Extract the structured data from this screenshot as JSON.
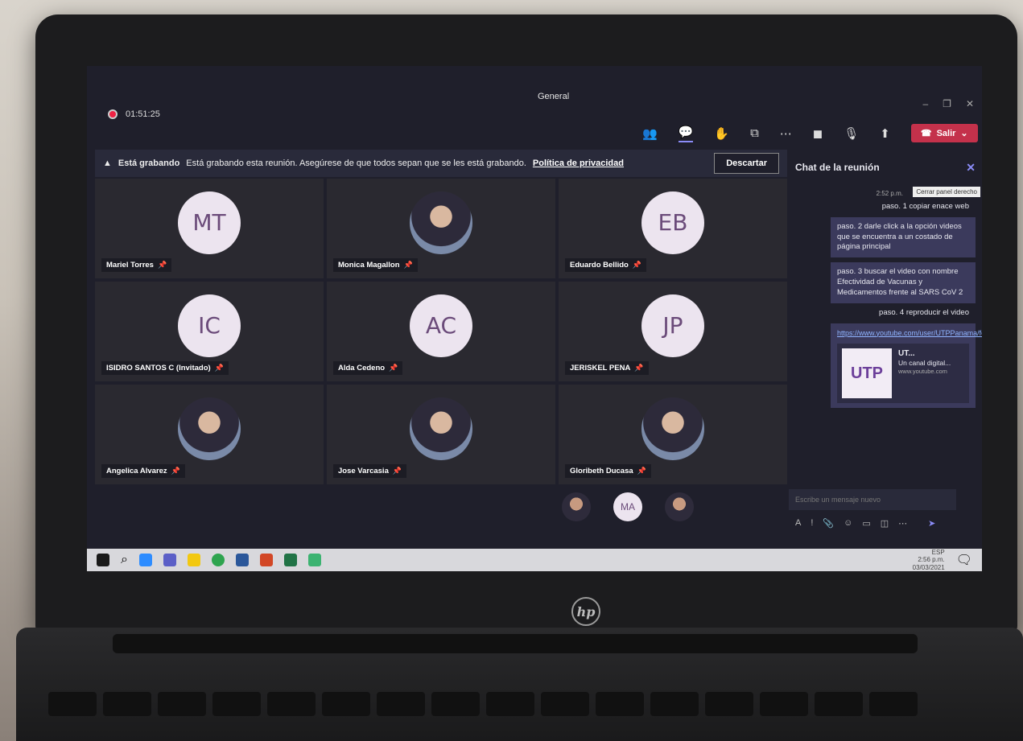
{
  "window": {
    "title": "General",
    "controls": [
      "–",
      "❐",
      "✕"
    ]
  },
  "recording": {
    "timer": "01:51:25"
  },
  "toolbar": {
    "leave_label": "Salir"
  },
  "banner": {
    "title": "Está grabando",
    "message": "Está grabando esta reunión. Asegúrese de que todos sepan que se les está grabando.",
    "link": "Política de privacidad",
    "dismiss": "Descartar"
  },
  "participants": [
    {
      "initials": "MT",
      "name": "Mariel Torres",
      "photo": false
    },
    {
      "initials": "",
      "name": "Monica Magallon",
      "photo": true
    },
    {
      "initials": "EB",
      "name": "Eduardo Bellido",
      "photo": false
    },
    {
      "initials": "IC",
      "name": "ISIDRO SANTOS C (Invitado)",
      "photo": false
    },
    {
      "initials": "AC",
      "name": "Alda Cedeno",
      "photo": false
    },
    {
      "initials": "JP",
      "name": "JERISKEL PENA",
      "photo": false
    },
    {
      "initials": "",
      "name": "Angelica Alvarez",
      "photo": true
    },
    {
      "initials": "",
      "name": "Jose Varcasia",
      "photo": true
    },
    {
      "initials": "",
      "name": "Gloribeth Ducasa",
      "photo": true
    }
  ],
  "strip": [
    {
      "initials": "",
      "photo": true
    },
    {
      "initials": "MA",
      "photo": false
    },
    {
      "initials": "",
      "photo": true
    }
  ],
  "chat": {
    "title": "Chat de la reunión",
    "tooltip": "Cerrar panel derecho",
    "timestamp": "2:52 p.m.",
    "messages": [
      "paso. 1 copiar enace web",
      "paso. 2 darle click a la opción videos que se encuentra a un costado de página principal",
      "paso. 3 buscar el video con nombre Efectividad de Vacunas y Medicamentos frente al SARS CoV 2",
      "paso. 4 reproducir el video"
    ],
    "link": "https://www.youtube.com/user/UTPPanama/featured",
    "card": {
      "logo": "UTP",
      "title": "UT...",
      "desc": "Un canal digital...",
      "url": "www.youtube.com"
    },
    "compose_placeholder": "Escribe un mensaje nuevo"
  },
  "taskbar": {
    "lang": "ESP",
    "time": "2:56 p.m.",
    "date": "03/03/2021"
  },
  "laptop": {
    "brand": "hp"
  }
}
